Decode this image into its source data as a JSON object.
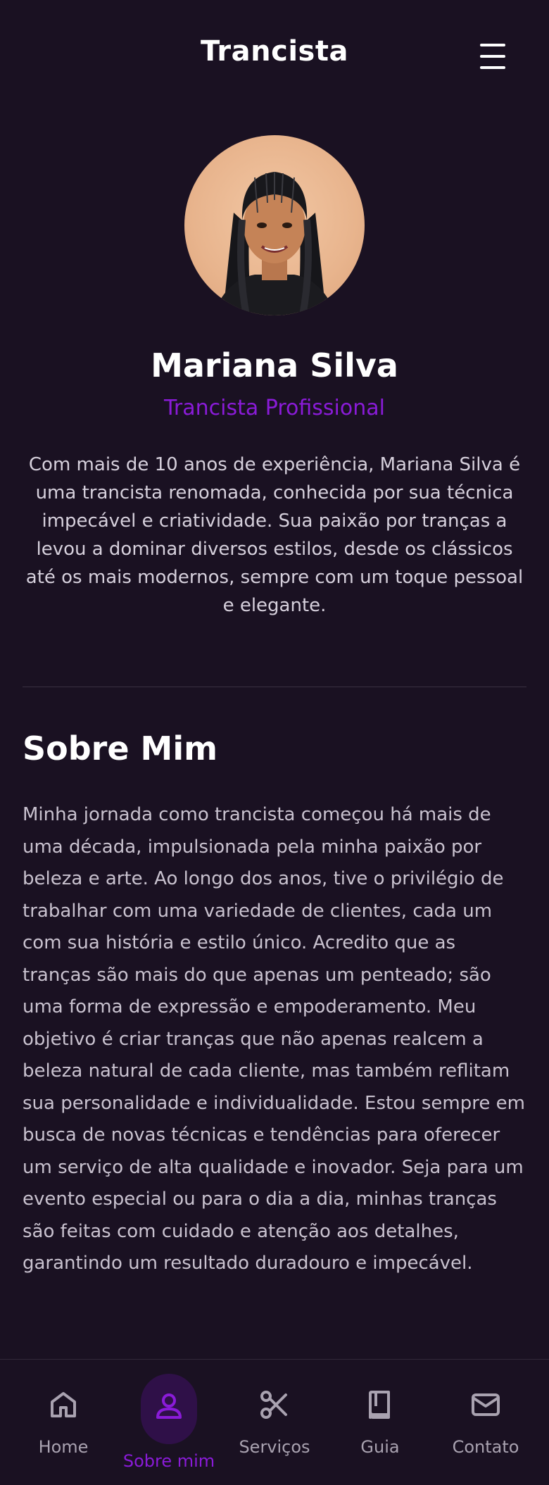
{
  "header": {
    "title": "Trancista"
  },
  "profile": {
    "name": "Mariana Silva",
    "role": "Trancista Profissional",
    "intro": "Com mais de 10 anos de experiência, Mariana Silva é uma trancista renomada, conhecida por sua técnica impecável e criatividade. Sua paixão por tranças a levou a dominar diversos estilos, desde os clássicos até os mais modernos, sempre com um toque pessoal e elegante."
  },
  "about": {
    "title": "Sobre Mim",
    "text": "Minha jornada como trancista começou há mais de uma década, impulsionada pela minha paixão por beleza e arte. Ao longo dos anos, tive o privilégio de trabalhar com uma variedade de clientes, cada um com sua história e estilo único. Acredito que as tranças são mais do que apenas um penteado; são uma forma de expressão e empoderamento. Meu objetivo é criar tranças que não apenas realcem a beleza natural de cada cliente, mas também reflitam sua personalidade e individualidade. Estou sempre em busca de novas técnicas e tendências para oferecer um serviço de alta qualidade e inovador. Seja para um evento especial ou para o dia a dia, minhas tranças são feitas com cuidado e atenção aos detalhes, garantindo um resultado duradouro e impecável."
  },
  "nav": {
    "items": [
      {
        "label": "Home",
        "icon": "home-icon"
      },
      {
        "label": "Sobre mim",
        "icon": "person-icon",
        "active": true
      },
      {
        "label": "Serviços",
        "icon": "scissors-icon"
      },
      {
        "label": "Guia",
        "icon": "book-icon"
      },
      {
        "label": "Contato",
        "icon": "mail-icon"
      }
    ]
  },
  "colors": {
    "background": "#1a1122",
    "accent": "#8a1bd8",
    "active_pill": "#2f1048"
  }
}
